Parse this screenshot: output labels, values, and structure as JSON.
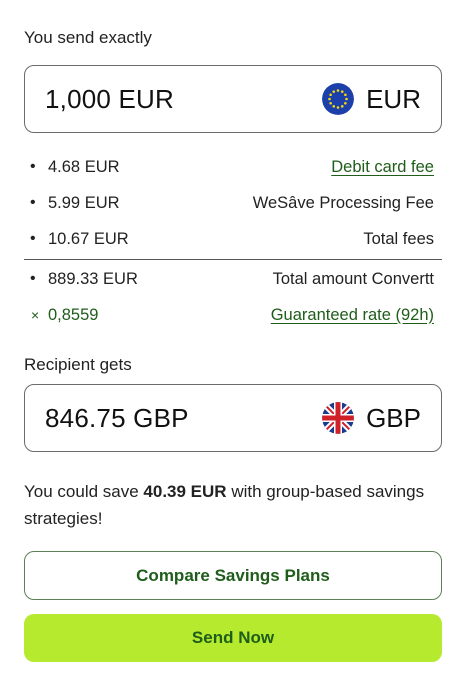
{
  "send": {
    "label": "You send exactly",
    "amount": "1,000 EUR",
    "currency": "EUR",
    "flag_icon": "eu-flag-icon"
  },
  "fees": {
    "rows": [
      {
        "bullet": "•",
        "amount": "4.68 EUR",
        "label": "Debit card fee"
      },
      {
        "bullet": "•",
        "amount": "5.99 EUR",
        "label": "WeSâve Processing Fee"
      },
      {
        "bullet": "•",
        "amount": "10.67 EUR",
        "label": "Total fees"
      },
      {
        "bullet": "•",
        "amount": "889.33 EUR",
        "label": "Total amount Convertt"
      },
      {
        "bullet": "×",
        "amount": "0,8559",
        "label": "Guaranteed rate (92h)"
      }
    ]
  },
  "receive": {
    "label": "Recipient gets",
    "amount": "846.75 GBP",
    "currency": "GBP",
    "flag_icon": "uk-flag-icon"
  },
  "savings": {
    "prefix": "You could save ",
    "amount": "40.39 EUR",
    "suffix": " with group-based savings strategies!"
  },
  "buttons": {
    "compare": "Compare Savings Plans",
    "send": "Send Now"
  },
  "colors": {
    "accent_green": "#1f5d1a",
    "send_button_bg": "#b5ea2e"
  }
}
